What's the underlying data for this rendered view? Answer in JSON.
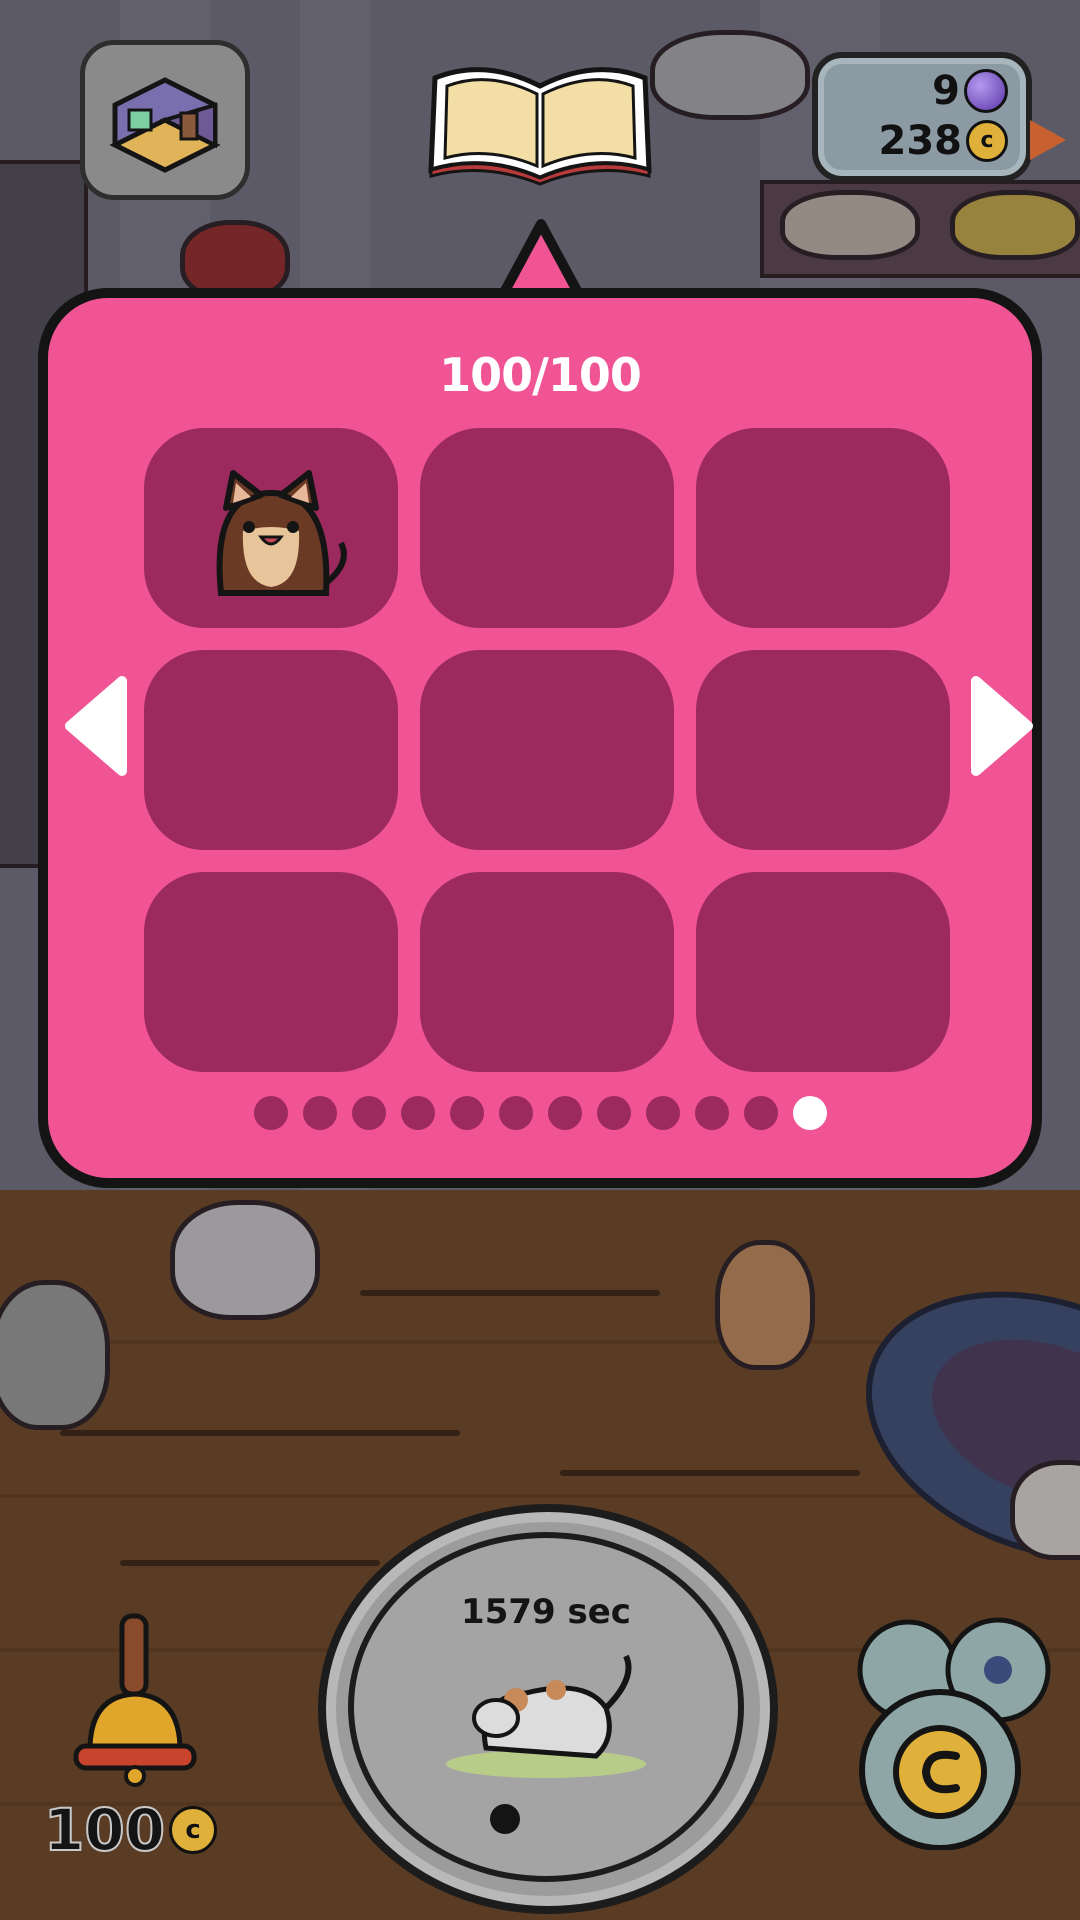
{
  "hud": {
    "gems": "9",
    "coins": "238",
    "coin_symbol": "c"
  },
  "collection": {
    "title": "100/100",
    "slots": [
      {
        "filled": true,
        "cat": "brown-bearded-cat-icon"
      },
      {
        "filled": false
      },
      {
        "filled": false
      },
      {
        "filled": false
      },
      {
        "filled": false
      },
      {
        "filled": false
      },
      {
        "filled": false
      },
      {
        "filled": false
      },
      {
        "filled": false
      }
    ],
    "page_count": 12,
    "current_page": 12
  },
  "bell": {
    "price": "100",
    "coin_symbol": "c"
  },
  "timer": {
    "text": "1579 sec"
  },
  "colors": {
    "popup": "#f05495",
    "slot": "#9c2a5e",
    "dot_active": "#ffffff"
  }
}
